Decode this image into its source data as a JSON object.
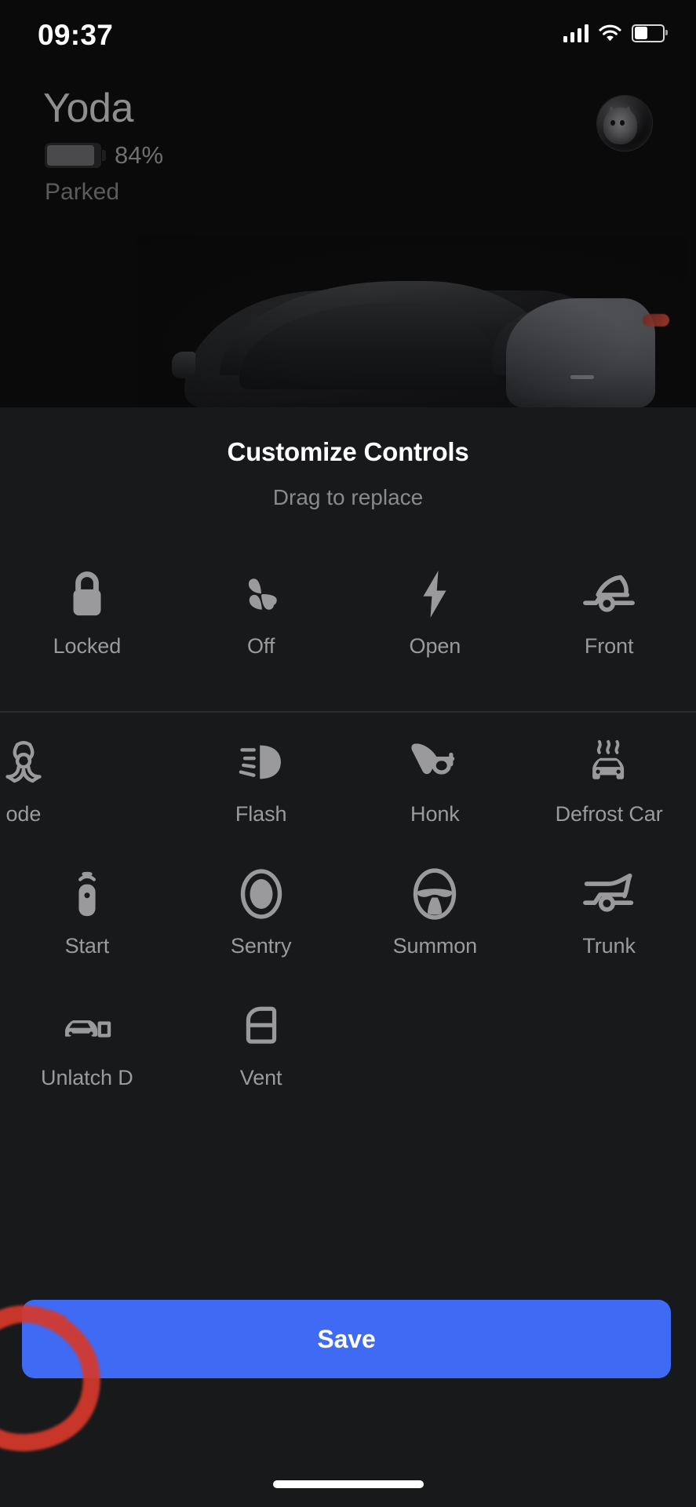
{
  "status_bar": {
    "time": "09:37",
    "cellular_icon": "cellular-signal-icon",
    "wifi_icon": "wifi-icon",
    "battery_icon": "battery-icon"
  },
  "vehicle": {
    "name": "Yoda",
    "battery_percent": "84%",
    "state": "Parked",
    "avatar_icon": "cat-avatar",
    "car_image": "tesla-model-y-render"
  },
  "sheet": {
    "title": "Customize Controls",
    "subtitle": "Drag to replace",
    "sections": [
      {
        "name": "current-controls",
        "items": [
          {
            "icon": "lock-closed-icon",
            "label": "Locked"
          },
          {
            "icon": "fan-icon",
            "label": "Off"
          },
          {
            "icon": "lightning-bolt-icon",
            "label": "Open"
          },
          {
            "icon": "frunk-icon",
            "label": "Front"
          }
        ]
      },
      {
        "name": "available-controls",
        "items": [
          {
            "icon": "biohazard-icon",
            "label": "ode",
            "dragging": true
          },
          {
            "icon": "headlight-flash-icon",
            "label": "Flash"
          },
          {
            "icon": "horn-icon",
            "label": "Honk"
          },
          {
            "icon": "defrost-car-icon",
            "label": "Defrost Car"
          },
          {
            "icon": "key-fob-icon",
            "label": "Start"
          },
          {
            "icon": "sentry-camera-icon",
            "label": "Sentry"
          },
          {
            "icon": "steering-wheel-icon",
            "label": "Summon"
          },
          {
            "icon": "trunk-icon",
            "label": "Trunk"
          },
          {
            "icon": "car-door-open-icon",
            "label": "Unlatch D"
          },
          {
            "icon": "car-door-vent-icon",
            "label": "Vent"
          }
        ]
      }
    ],
    "save_label": "Save"
  },
  "annotation": {
    "shape": "hand-drawn-circle",
    "color": "#d6392b",
    "targets": "Unlatch D"
  },
  "colors": {
    "accent_blue": "#3f6af4",
    "sheet_background": "#18191b",
    "page_background": "#0a0a0b",
    "icon_grey": "#9a9a9d",
    "label_grey": "#9b9b9e",
    "annotation_red": "#d6392b"
  }
}
